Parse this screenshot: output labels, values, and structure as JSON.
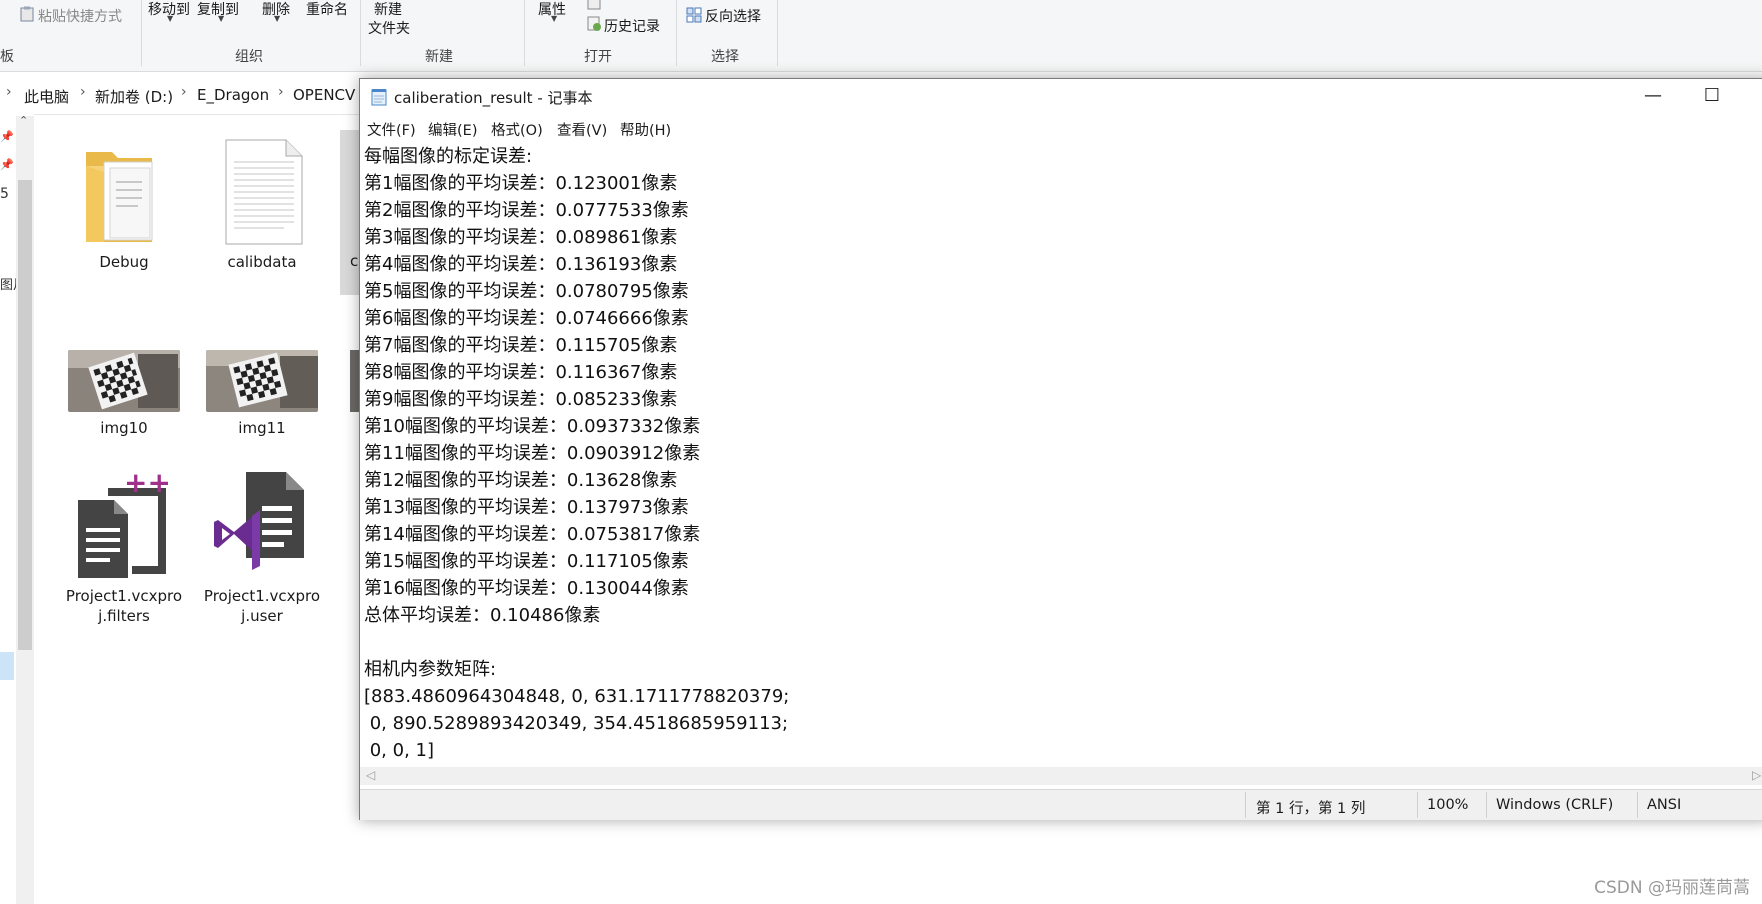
{
  "ribbon": {
    "paste_shortcut": "粘贴快捷方式",
    "move_to": "移动到",
    "copy_to": "复制到",
    "delete": "删除",
    "rename": "重命名",
    "new_folder_line1": "新建",
    "new_folder_line2": "文件夹",
    "properties": "属性",
    "history": "历史记录",
    "invert_selection": "反向选择",
    "group_clipboard_fragment": "板",
    "group_organize": "组织",
    "group_new": "新建",
    "group_open": "打开",
    "group_select": "选择"
  },
  "address": {
    "crumbs": [
      "此电脑",
      "新加卷 (D:)",
      "E_Dragon",
      "OPENCV"
    ]
  },
  "nav": {
    "fragments": [
      "5",
      "图片"
    ]
  },
  "files": [
    {
      "name": "Debug",
      "icon": "folder-icon"
    },
    {
      "name": "calibdata",
      "icon": "text-file-icon"
    },
    {
      "name": "img10",
      "icon": "image-thumbnail"
    },
    {
      "name": "img11",
      "icon": "image-thumbnail"
    },
    {
      "name_line1": "Project1.vcxpro",
      "name_line2": "j.filters",
      "icon": "cpp-project-filters-icon"
    },
    {
      "name_line1": "Project1.vcxpro",
      "name_line2": "j.user",
      "icon": "visual-studio-icon"
    }
  ],
  "partial_file_label": "c",
  "notepad": {
    "title": "caliberation_result - 记事本",
    "menu": [
      "文件(F)",
      "编辑(E)",
      "格式(O)",
      "查看(V)",
      "帮助(H)"
    ],
    "content_lines": [
      "每幅图像的标定误差:",
      "第1幅图像的平均误差：0.123001像素",
      "第2幅图像的平均误差：0.0777533像素",
      "第3幅图像的平均误差：0.089861像素",
      "第4幅图像的平均误差：0.136193像素",
      "第5幅图像的平均误差：0.0780795像素",
      "第6幅图像的平均误差：0.0746666像素",
      "第7幅图像的平均误差：0.115705像素",
      "第8幅图像的平均误差：0.116367像素",
      "第9幅图像的平均误差：0.085233像素",
      "第10幅图像的平均误差：0.0937332像素",
      "第11幅图像的平均误差：0.0903912像素",
      "第12幅图像的平均误差：0.13628像素",
      "第13幅图像的平均误差：0.137973像素",
      "第14幅图像的平均误差：0.0753817像素",
      "第15幅图像的平均误差：0.117105像素",
      "第16幅图像的平均误差：0.130044像素",
      "总体平均误差：0.10486像素",
      "",
      "相机内参数矩阵:",
      "[883.4860964304848, 0, 631.1711778820379;",
      " 0, 890.5289893420349, 354.4518685959113;",
      " 0, 0, 1]"
    ],
    "status": {
      "position": "第 1 行，第 1 列",
      "zoom": "100%",
      "line_ending": "Windows (CRLF)",
      "encoding": "ANSI"
    }
  },
  "watermark": "CSDN @玛丽莲茼蒿"
}
